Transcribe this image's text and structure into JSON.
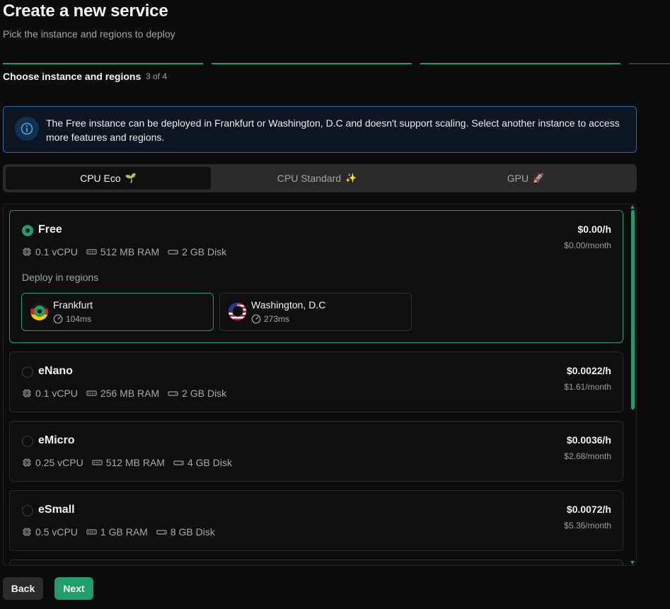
{
  "header": {
    "title": "Create a new service",
    "subtitle": "Pick the instance and regions to deploy"
  },
  "step": {
    "title": "Choose instance and regions",
    "count": "3 of 4",
    "current": 3,
    "total": 4
  },
  "info": {
    "text": "The Free instance can be deployed in Frankfurt or Washington, D.C and doesn't support scaling. Select another instance to access more features and regions."
  },
  "tabs": [
    {
      "label": "CPU Eco",
      "emoji": "🌱",
      "active": true
    },
    {
      "label": "CPU Standard",
      "emoji": "✨",
      "active": false
    },
    {
      "label": "GPU",
      "emoji": "🚀",
      "active": false
    }
  ],
  "instances": [
    {
      "name": "Free",
      "selected": true,
      "vcpu": "0.1 vCPU",
      "ram": "512 MB RAM",
      "disk": "2 GB Disk",
      "price_hour": "$0.00/h",
      "price_month": "$0.00/month",
      "deploy_label": "Deploy in regions",
      "regions": [
        {
          "name": "Frankfurt",
          "latency": "104ms",
          "flag": "de-flag",
          "selected": true
        },
        {
          "name": "Washington, D.C",
          "latency": "273ms",
          "flag": "us-flag",
          "selected": false
        }
      ]
    },
    {
      "name": "eNano",
      "selected": false,
      "vcpu": "0.1 vCPU",
      "ram": "256 MB RAM",
      "disk": "2 GB Disk",
      "price_hour": "$0.0022/h",
      "price_month": "$1.61/month"
    },
    {
      "name": "eMicro",
      "selected": false,
      "vcpu": "0.25 vCPU",
      "ram": "512 MB RAM",
      "disk": "4 GB Disk",
      "price_hour": "$0.0036/h",
      "price_month": "$2.68/month"
    },
    {
      "name": "eSmall",
      "selected": false,
      "vcpu": "0.5 vCPU",
      "ram": "1 GB RAM",
      "disk": "8 GB Disk",
      "price_hour": "$0.0072/h",
      "price_month": "$5.36/month"
    }
  ],
  "buttons": {
    "back": "Back",
    "next": "Next"
  },
  "colors": {
    "accent": "#1f9d6a",
    "background": "#0c0c0d",
    "info_border": "#2b6a9f"
  }
}
